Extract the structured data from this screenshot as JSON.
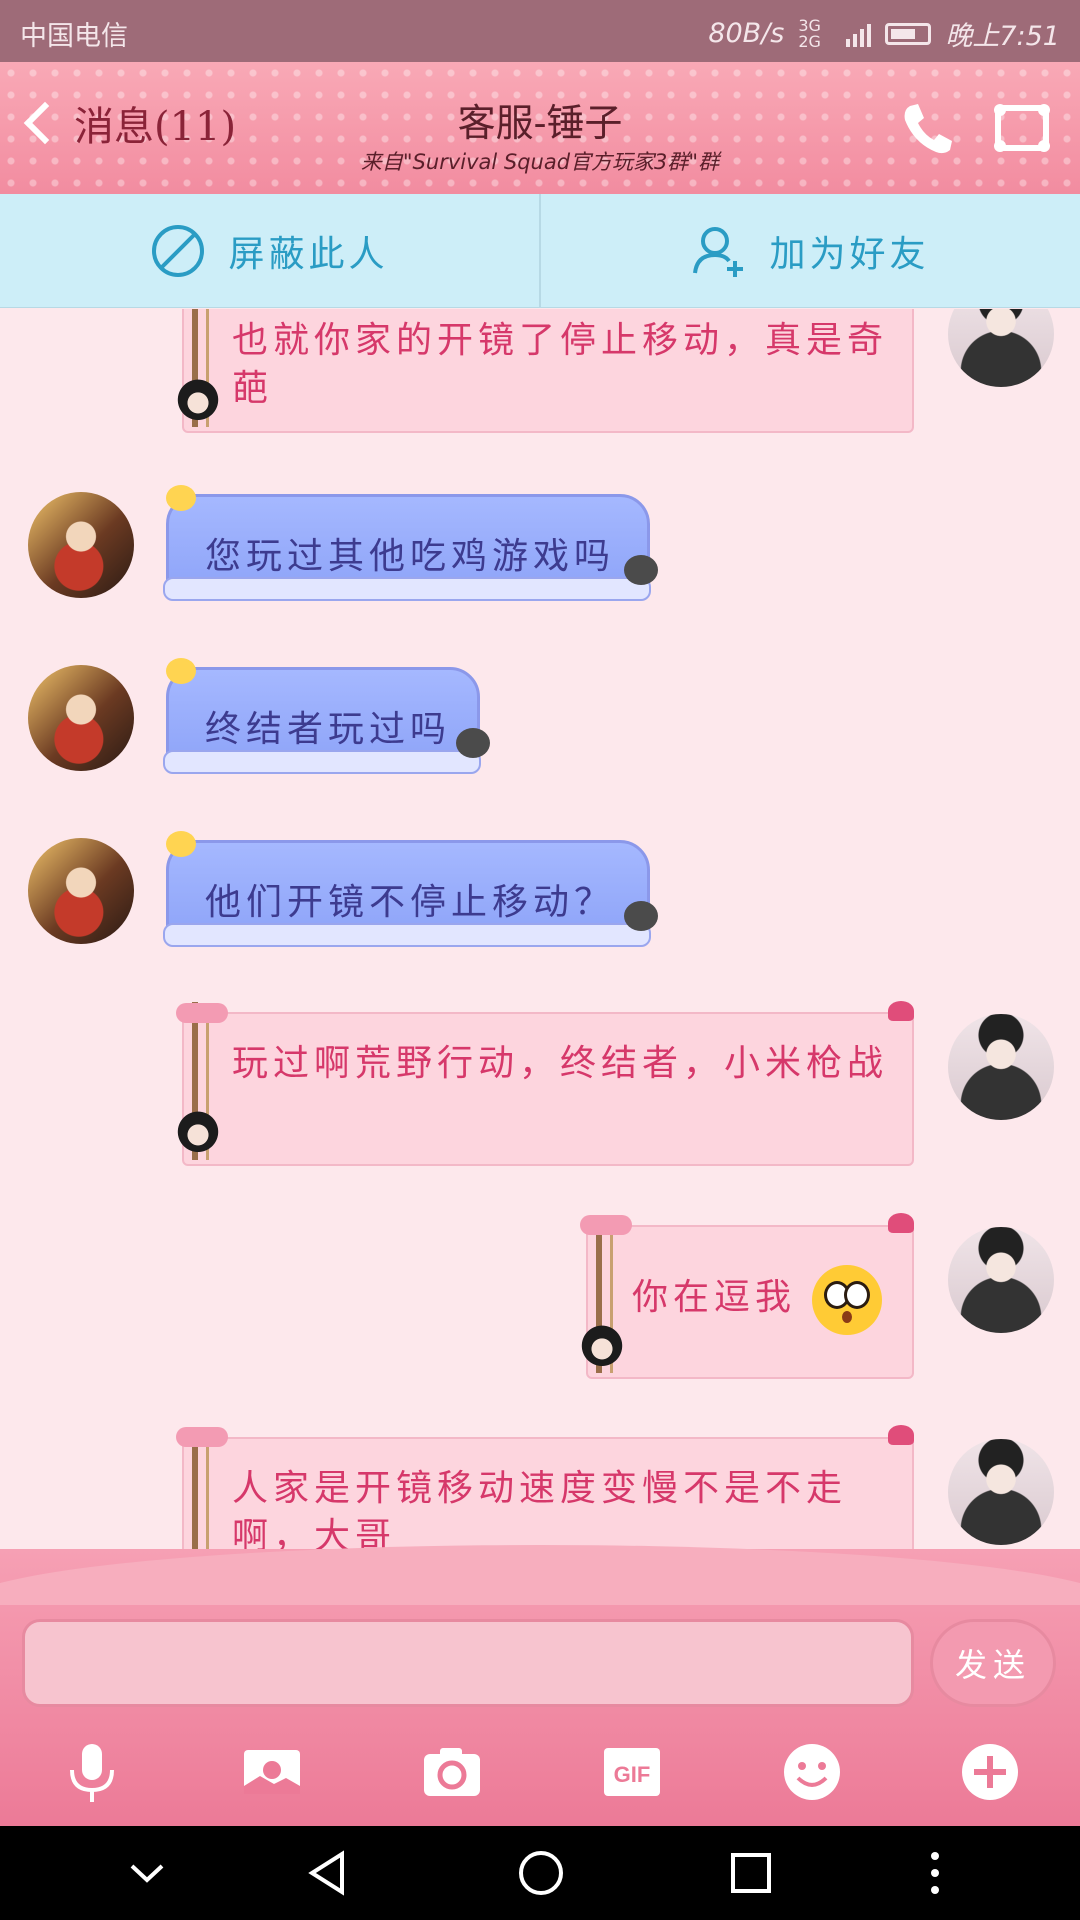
{
  "status": {
    "carrier": "中国电信",
    "speed": "80B/s",
    "network": "3G 2G",
    "time": "晚上7:51"
  },
  "header": {
    "back_label": "消息(11)",
    "title": "客服-锤子",
    "subtitle": "来自\"Survival Squad官方玩家3群\"群",
    "phone_icon": "phone-icon",
    "group_icon": "group-icon"
  },
  "actions": {
    "block": "屏蔽此人",
    "add_friend": "加为好友"
  },
  "messages": [
    {
      "side": "right",
      "style": "pink",
      "text": "也就你家的开镜了停止移动，真是奇葩"
    },
    {
      "side": "left",
      "style": "blue",
      "text": "您玩过其他吃鸡游戏吗"
    },
    {
      "side": "left",
      "style": "blue",
      "text": "终结者玩过吗"
    },
    {
      "side": "left",
      "style": "blue",
      "text": "他们开镜不停止移动？"
    },
    {
      "side": "right",
      "style": "pink",
      "text": "玩过啊荒野行动，终结者，小米枪战"
    },
    {
      "side": "right",
      "style": "pink",
      "text": "你在逗我",
      "emoji": "astonished-emoji"
    },
    {
      "side": "right",
      "style": "pink",
      "text": "人家是开镜移动速度变慢不是不走啊，大哥"
    }
  ],
  "composer": {
    "send_label": "发送",
    "input_value": ""
  },
  "toolbar": [
    "microphone-icon",
    "image-icon",
    "camera-icon",
    "gif-icon",
    "emoji-icon",
    "plus-icon"
  ],
  "toolbar_gif_label": "GIF",
  "colors": {
    "header": "#f28ca0",
    "action_bar": "#cdeef8",
    "action_text": "#2a9cc4",
    "pink_text": "#d6386a",
    "blue_text": "#3d3b8f"
  }
}
